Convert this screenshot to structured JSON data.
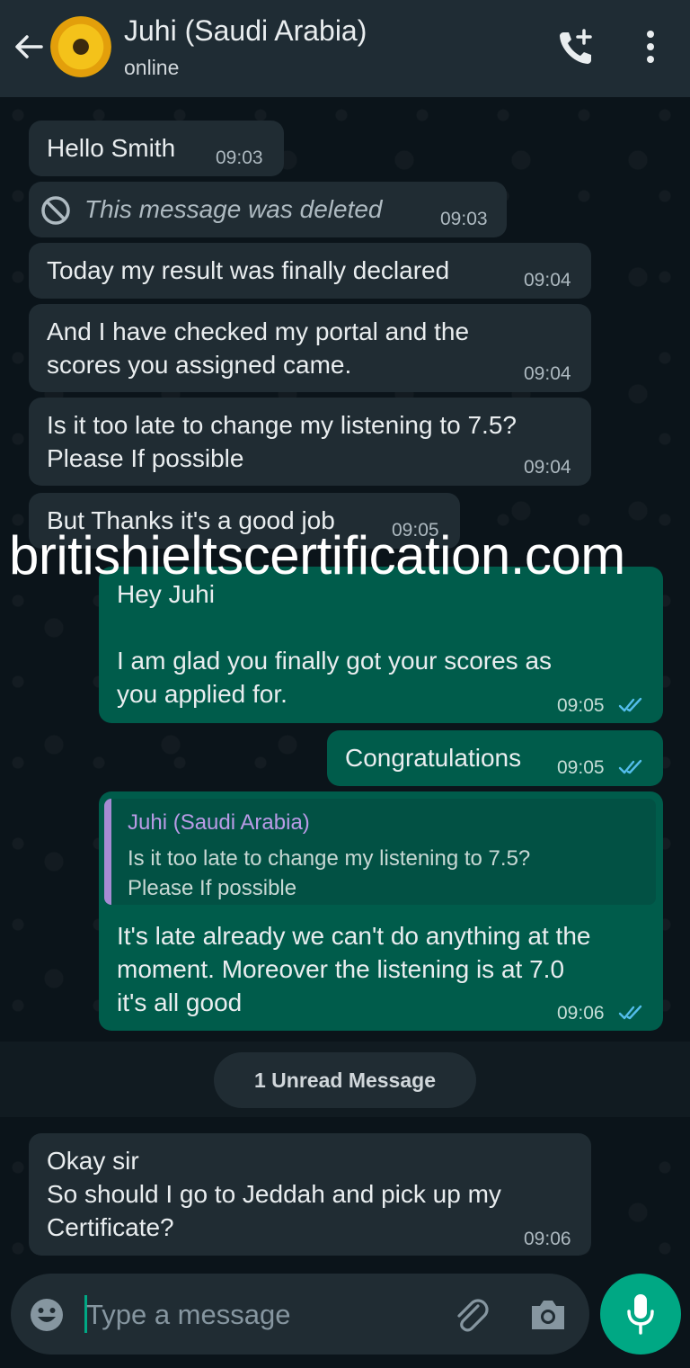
{
  "header": {
    "contact_name": "Juhi (Saudi Arabia)",
    "status": "online"
  },
  "messages": [
    {
      "text": "Hello Smith",
      "time": "09:03",
      "direction": "in"
    },
    {
      "text": "This message was deleted",
      "time": "09:03",
      "direction": "in",
      "deleted": true
    },
    {
      "text": "Today my result was finally declared",
      "time": "09:04",
      "direction": "in"
    },
    {
      "text": "And I have checked my portal and the\nscores you assigned came.",
      "time": "09:04",
      "direction": "in"
    },
    {
      "text": "Is it too late to change my listening to 7.5?\nPlease If possible",
      "time": "09:04",
      "direction": "in"
    },
    {
      "text": "But Thanks it's a good job",
      "time": "09:05",
      "direction": "in"
    },
    {
      "text": "Hey Juhi\n\nI am glad you finally got your scores as\nyou applied for.",
      "time": "09:05",
      "direction": "out",
      "status": "read"
    },
    {
      "text": "Congratulations",
      "time": "09:05",
      "direction": "out",
      "status": "read"
    },
    {
      "quote_author": "Juhi (Saudi Arabia)",
      "quote_text": "Is it too late to change my listening to 7.5?\nPlease If possible",
      "text": "It's late already we can't do anything at the\nmoment. Moreover the listening is at 7.0\nit's all good",
      "time": "09:06",
      "direction": "out",
      "status": "read"
    },
    {
      "text": "Okay sir\nSo should I go to Jeddah and pick up my\nCertificate?",
      "time": "09:06",
      "direction": "in"
    }
  ],
  "unread_label": "1 Unread Message",
  "watermark": "britishieltscertification.com",
  "composer": {
    "placeholder": "Type a message"
  },
  "colors": {
    "incoming_bubble": "#202c33",
    "outgoing_bubble": "#005c4b",
    "accent": "#00a884",
    "read_ticks": "#53bdeb",
    "header": "#1f2c34"
  },
  "icons": [
    "back-arrow-icon",
    "avatar",
    "add-call-icon",
    "more-vert-icon",
    "ban-icon",
    "double-check-icon",
    "emoji-icon",
    "attach-icon",
    "camera-icon",
    "mic-icon"
  ]
}
